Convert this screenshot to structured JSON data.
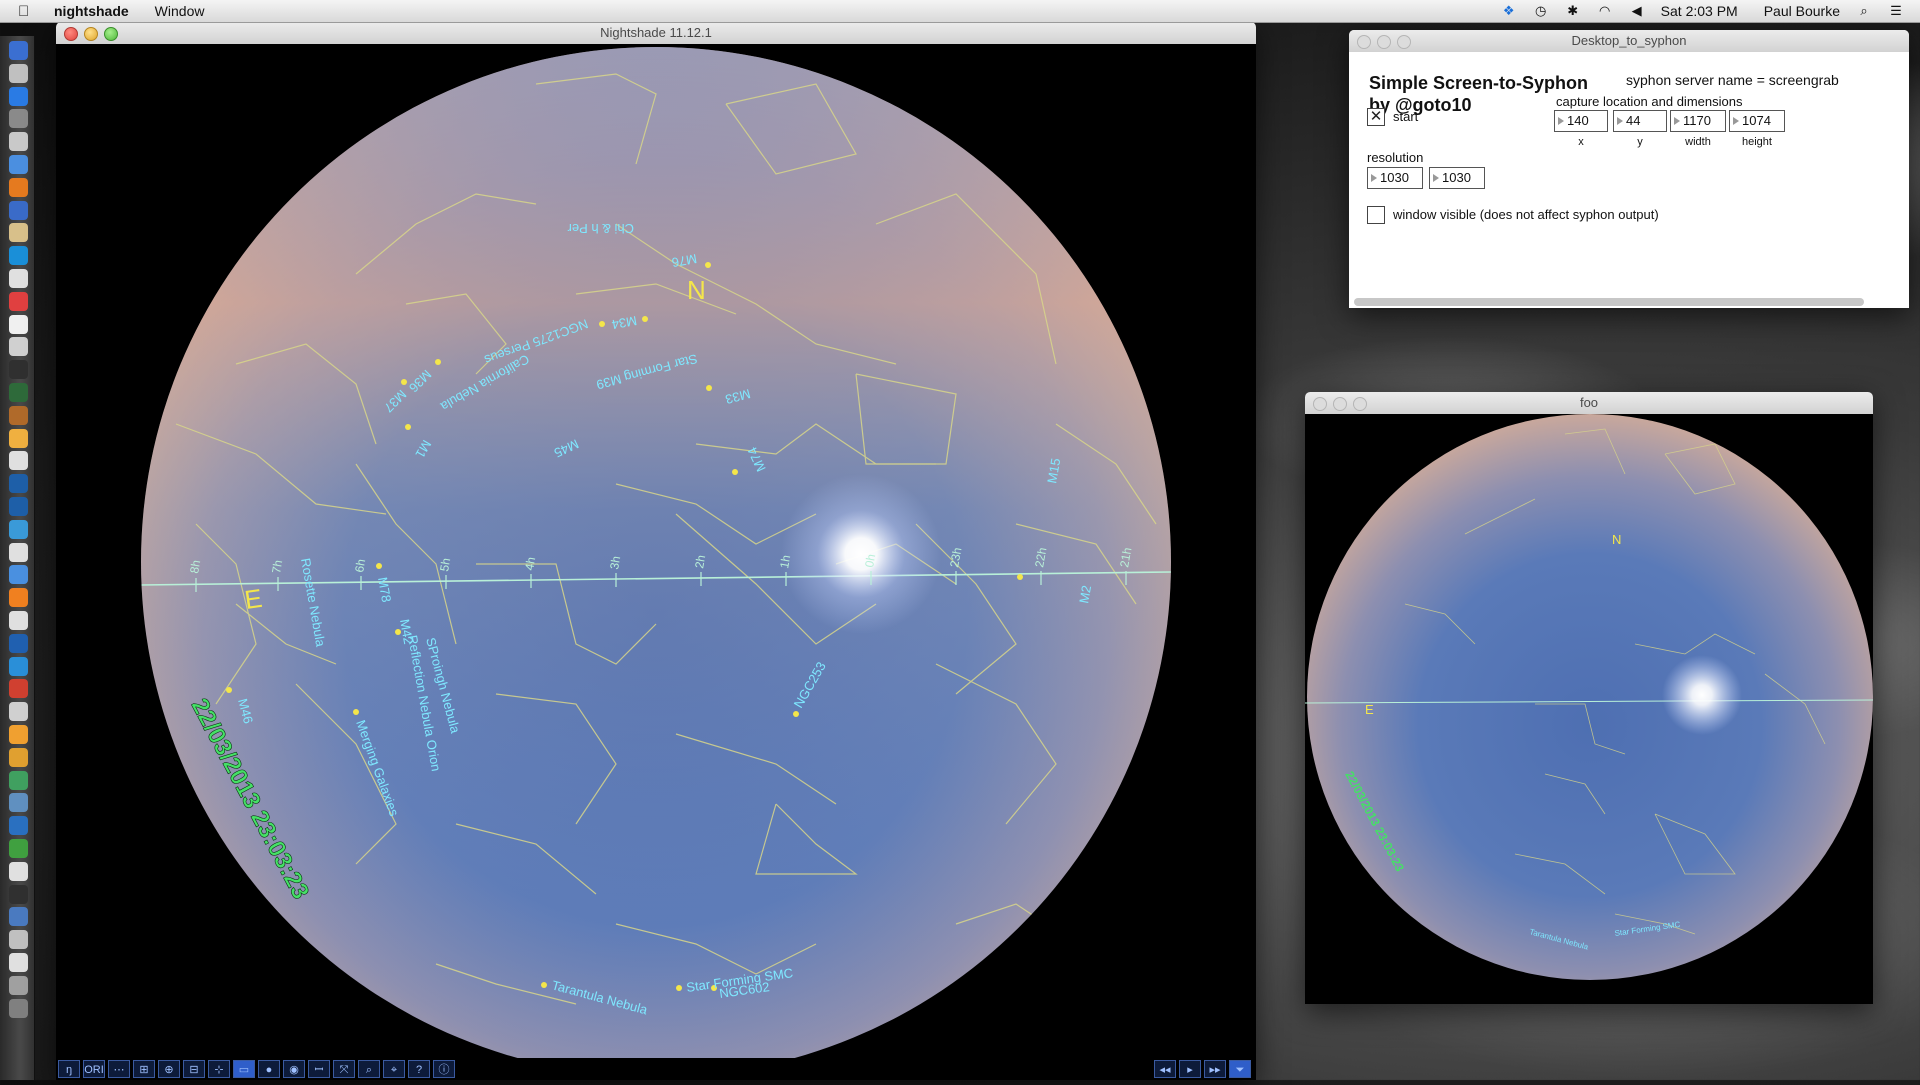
{
  "menubar": {
    "app_name": "nightshade",
    "menu_window": "Window",
    "clock": "Sat 2:03 PM",
    "user": "Paul Bourke"
  },
  "nightshade_window": {
    "title": "Nightshade 11.12.1",
    "sky_labels": {
      "chi_h_per": "Chi & h Per",
      "m76": "M76",
      "north": "N",
      "m34": "M34",
      "ngc1275": "NGC1275 Perseus",
      "california": "California Nebula",
      "m36": "M36",
      "m37": "M37",
      "m39": "Star Forming M39",
      "m33": "M33",
      "m45": "M45",
      "m1": "M1",
      "m74": "M74",
      "m15": "M15",
      "east": "E",
      "rosette": "Rosette Nebula",
      "m78": "M78",
      "m42": "M42",
      "reflection": "Reflection Nebula Orion",
      "sproingk": "SProingh Nebula",
      "ngc253": "NGC253",
      "m46": "M46",
      "merging": "Merging Galaxies",
      "datetime": "22/03/2013 23:03:23",
      "tarantula": "Tarantula Nebula",
      "smc": "Star Forming SMC",
      "ngc602": "NGC602",
      "m2": "M2",
      "ra_ticks": [
        "8h",
        "7h",
        "6h",
        "5h",
        "4h",
        "3h",
        "2h",
        "1h",
        "0h",
        "23h",
        "22h",
        "21h"
      ]
    },
    "toolbar_left": [
      "ŋ",
      "ORI",
      "⋯",
      "⊞",
      "⊕",
      "⊟",
      "⊹",
      "▭",
      "●",
      "◉",
      "ꟷ",
      "⤧",
      "⌕",
      "⌖",
      "?",
      "ⓘ"
    ],
    "toolbar_right": [
      "◂◂",
      "▸",
      "▸▸",
      "⏷"
    ]
  },
  "syphon_window": {
    "title": "Desktop_to_syphon",
    "heading_line1": "Simple Screen-to-Syphon",
    "heading_line2": "by @goto10",
    "server_name": "syphon server name = screengrab",
    "start_label": "start",
    "start_checked": "✕",
    "capture_label": "capture location and dimensions",
    "x_value": "140",
    "y_value": "44",
    "width_value": "1170",
    "height_value": "1074",
    "x_caption": "x",
    "y_caption": "y",
    "width_caption": "width",
    "height_caption": "height",
    "resolution_label": "resolution",
    "res_w": "1030",
    "res_h": "1030",
    "visible_label": "window visible (does not affect syphon output)"
  },
  "foo_window": {
    "title": "foo",
    "labels": {
      "north": "N",
      "east": "E",
      "tarantula": "Tarantula Nebula",
      "smc": "Star Forming SMC",
      "datetime": "22/03/2013 23:03:23"
    }
  },
  "colors": {
    "sky_blue": "#5a7ab8",
    "sky_pink": "#d9a89a",
    "constellation": "#d8d68a",
    "label_cyan": "#7fe8ff",
    "compass_yellow": "#f4e64a",
    "datetime_green": "#45e066"
  }
}
